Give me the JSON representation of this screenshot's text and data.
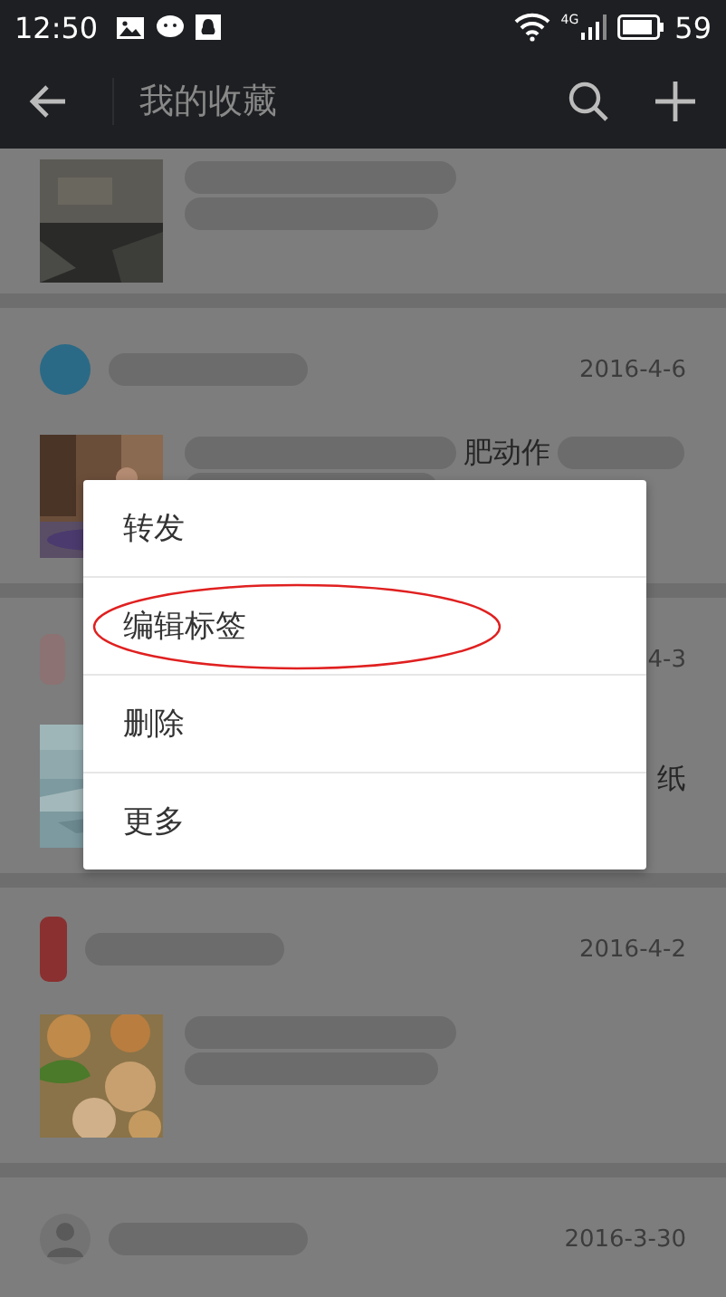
{
  "status_bar": {
    "time": "12:50",
    "network": "4G",
    "battery": "59"
  },
  "app_bar": {
    "title": "我的收藏"
  },
  "favorites": [
    {
      "thumbnail": {
        "kind": "picture"
      }
    },
    {
      "avatar": {
        "kind": "round",
        "color": "#2a6a86"
      },
      "date": "2016-4-6",
      "snippet": {
        "kind": "inline",
        "text": "肥动作"
      },
      "thumbnail": {
        "kind": "picture"
      }
    },
    {
      "avatar": {
        "kind": "square",
        "color": "#8c7272"
      },
      "date": "4-3",
      "snippet": {
        "kind": "end",
        "text": "纸"
      },
      "thumbnail": {
        "kind": "picture"
      }
    },
    {
      "avatar": {
        "kind": "square",
        "color": "#8a3030"
      },
      "date": "2016-4-2",
      "thumbnail": {
        "kind": "picture"
      }
    },
    {
      "avatar": {
        "kind": "person"
      },
      "date": "2016-3-30"
    }
  ],
  "context_menu": {
    "items": [
      {
        "label": "转发",
        "circled": false
      },
      {
        "label": "编辑标签",
        "circled": true
      },
      {
        "label": "删除",
        "circled": false
      },
      {
        "label": "更多",
        "circled": false
      }
    ]
  }
}
